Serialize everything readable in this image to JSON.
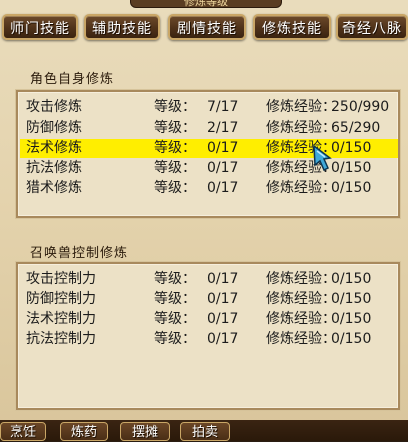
{
  "window": {
    "title": "修炼等级"
  },
  "tabs": [
    {
      "label": "师门技能"
    },
    {
      "label": "辅助技能"
    },
    {
      "label": "剧情技能"
    },
    {
      "label": "修炼技能"
    },
    {
      "label": "奇经八脉"
    }
  ],
  "self_section": {
    "title": "角色自身修炼",
    "rows": [
      {
        "name": "攻击修炼",
        "level_label": "等级：",
        "level": "7/17",
        "exp_label": "修炼经验：",
        "exp": "250/990"
      },
      {
        "name": "防御修炼",
        "level_label": "等级：",
        "level": "2/17",
        "exp_label": "修炼经验：",
        "exp": "65/290"
      },
      {
        "name": "法术修炼",
        "level_label": "等级：",
        "level": "0/17",
        "exp_label": "修炼经验：",
        "exp": "0/150"
      },
      {
        "name": "抗法修炼",
        "level_label": "等级：",
        "level": "0/17",
        "exp_label": "修炼经验：",
        "exp": "0/150"
      },
      {
        "name": "猎术修炼",
        "level_label": "等级：",
        "level": "0/17",
        "exp_label": "修炼经验：",
        "exp": "0/150"
      }
    ]
  },
  "pet_section": {
    "title": "召唤兽控制修炼",
    "rows": [
      {
        "name": "攻击控制力",
        "level_label": "等级：",
        "level": "0/17",
        "exp_label": "修炼经验：",
        "exp": "0/150"
      },
      {
        "name": "防御控制力",
        "level_label": "等级：",
        "level": "0/17",
        "exp_label": "修炼经验：",
        "exp": "0/150"
      },
      {
        "name": "法术控制力",
        "level_label": "等级：",
        "level": "0/17",
        "exp_label": "修炼经验：",
        "exp": "0/150"
      },
      {
        "name": "抗法控制力",
        "level_label": "等级：",
        "level": "0/17",
        "exp_label": "修炼经验：",
        "exp": "0/150"
      }
    ]
  },
  "bottom_buttons": [
    {
      "label": "烹饪"
    },
    {
      "label": "炼药"
    },
    {
      "label": "摆摊"
    },
    {
      "label": "拍卖"
    }
  ],
  "colors": {
    "highlight": "#ffee00",
    "tab_border": "#c9a666",
    "panel_bg": "#ece1c6"
  }
}
